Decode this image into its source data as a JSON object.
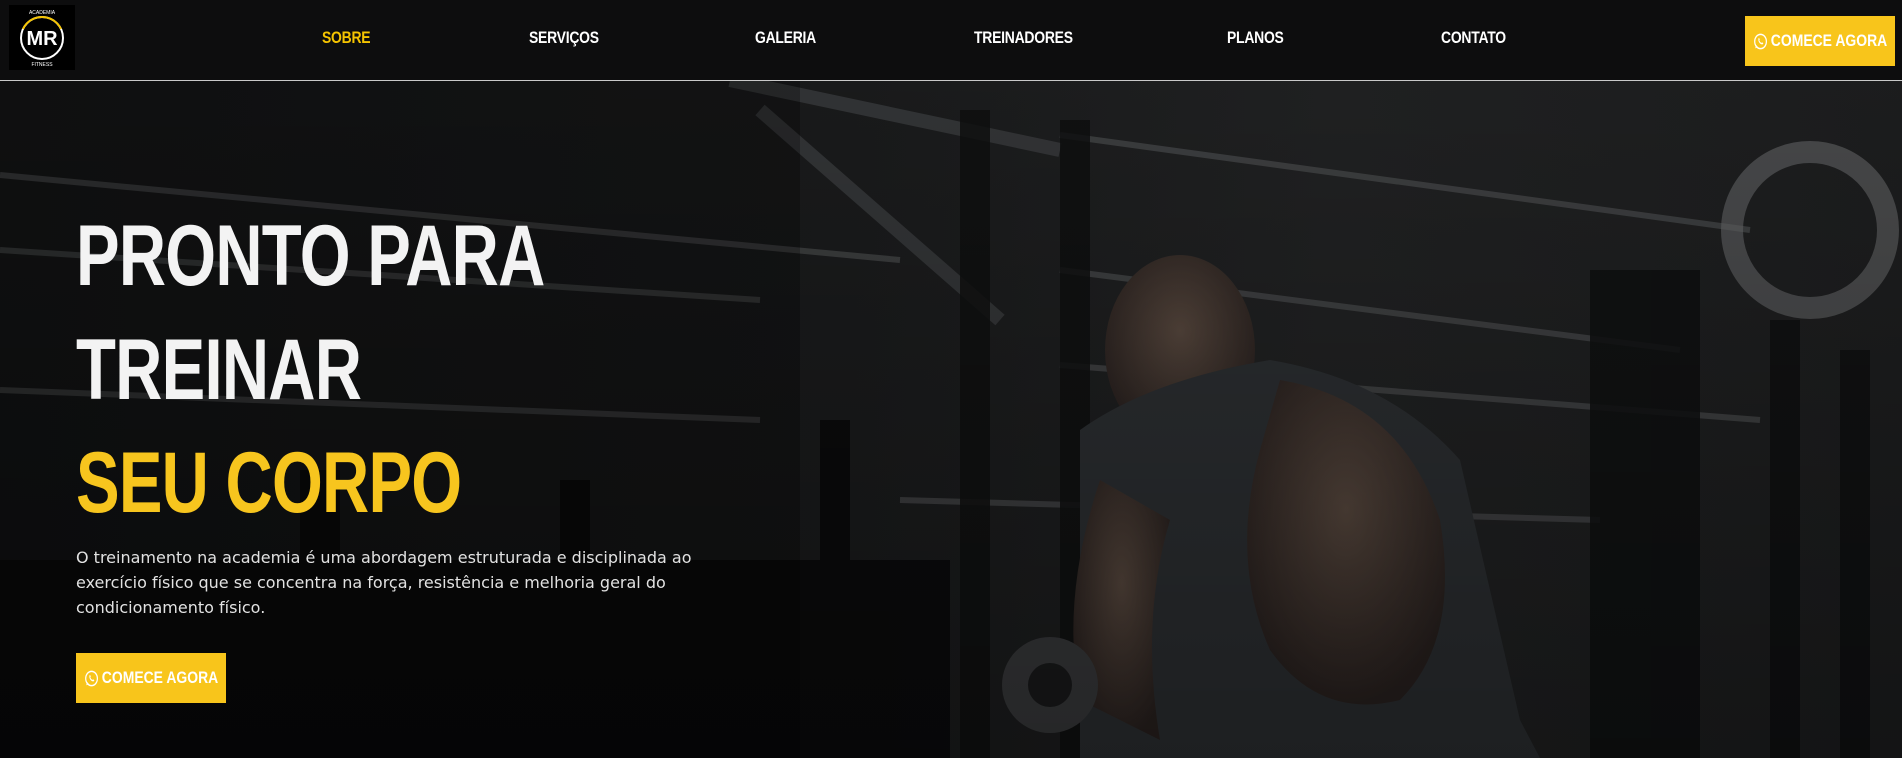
{
  "navbar": {
    "logo": {
      "icon": "mr-fitness-logo-icon",
      "top_text": "ACADEMIA",
      "mark": "MR",
      "bottom_text": "FITNESS"
    },
    "items": [
      {
        "label": "SOBRE",
        "active": true
      },
      {
        "label": "SERVIÇOS",
        "active": false
      },
      {
        "label": "GALERIA",
        "active": false
      },
      {
        "label": "TREINADORES",
        "active": false
      },
      {
        "label": "PLANOS",
        "active": false
      },
      {
        "label": "CONTATO",
        "active": false
      }
    ],
    "cta_label": "COMECE AGORA",
    "cta_icon": "whatsapp-icon"
  },
  "hero": {
    "line1": "PRONTO PARA",
    "line2": "TREINAR",
    "line3": "SEU CORPO",
    "description": "O treinamento na academia é uma abordagem estruturada e disciplinada ao exercício físico que se concentra na força, resistência e melhoria geral do condicionamento físico.",
    "cta_label": "COMECE AGORA",
    "cta_icon": "whatsapp-icon",
    "background": "gym-athlete-dumbbell-image"
  },
  "colors": {
    "accent": "#f8c51b",
    "nav_background": "#0d0d0e",
    "text_light": "#ffffff"
  }
}
